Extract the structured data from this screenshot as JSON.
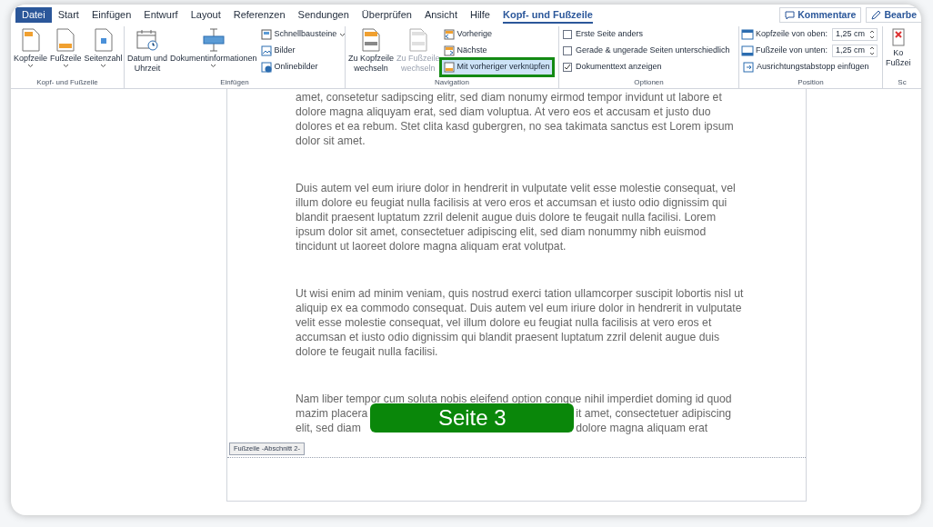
{
  "tabs": [
    {
      "label": "Datei",
      "kind": "file",
      "selected": false
    },
    {
      "label": "Start",
      "kind": "tab",
      "selected": false
    },
    {
      "label": "Einfügen",
      "kind": "tab",
      "selected": false
    },
    {
      "label": "Entwurf",
      "kind": "tab",
      "selected": false
    },
    {
      "label": "Layout",
      "kind": "tab",
      "selected": false
    },
    {
      "label": "Referenzen",
      "kind": "tab",
      "selected": false
    },
    {
      "label": "Sendungen",
      "kind": "tab",
      "selected": false
    },
    {
      "label": "Überprüfen",
      "kind": "tab",
      "selected": false
    },
    {
      "label": "Ansicht",
      "kind": "tab",
      "selected": false
    },
    {
      "label": "Hilfe",
      "kind": "tab",
      "selected": false
    },
    {
      "label": "Kopf- und Fußzeile",
      "kind": "tab",
      "selected": true
    }
  ],
  "top_buttons": [
    {
      "label": "Kommentare"
    },
    {
      "label": "Bearbe"
    }
  ],
  "ribbon_groups": [
    {
      "label": "Kopf- und Fußzeile",
      "items": [
        {
          "kind": "large",
          "lines": [
            "Kopfzeile"
          ],
          "dropdown": true
        },
        {
          "kind": "large",
          "lines": [
            "Fußzeile"
          ],
          "dropdown": true
        },
        {
          "kind": "large",
          "lines": [
            "Seitenzahl"
          ],
          "dropdown": true
        }
      ]
    },
    {
      "label": "Einfügen",
      "items": [
        {
          "kind": "large",
          "lines": [
            "Datum und",
            "Uhrzeit"
          ],
          "dropdown": false
        },
        {
          "kind": "large",
          "lines": [
            "Dokumentinformationen"
          ],
          "dropdown": true
        },
        {
          "kind": "small",
          "label": "Schnellbausteine",
          "dropdown": true
        },
        {
          "kind": "small",
          "label": "Bilder",
          "dropdown": false
        },
        {
          "kind": "small",
          "label": "Onlinebilder",
          "dropdown": false
        }
      ]
    },
    {
      "label": "Navigation",
      "items": [
        {
          "kind": "large",
          "lines": [
            "Zu Kopfzeile",
            "wechseln"
          ],
          "dropdown": false,
          "disabled": false,
          "on": false,
          "highlighted": false
        },
        {
          "kind": "large",
          "lines": [
            "Zu Fußzeile",
            "wechseln"
          ],
          "dropdown": false,
          "disabled": true,
          "on": false,
          "highlighted": false
        },
        {
          "kind": "small",
          "label": "Vorherige",
          "dropdown": false,
          "disabled": false,
          "on": false,
          "highlighted": false
        },
        {
          "kind": "small",
          "label": "Nächste",
          "dropdown": false,
          "disabled": false,
          "on": false,
          "highlighted": false
        },
        {
          "kind": "small",
          "label": "Mit vorheriger verknüpfen",
          "dropdown": false,
          "disabled": false,
          "on": true,
          "highlighted": true
        }
      ]
    },
    {
      "label": "Optionen",
      "items": [
        {
          "kind": "check",
          "label": "Erste Seite anders",
          "checked": false
        },
        {
          "kind": "check",
          "label": "Gerade & ungerade Seiten unterschiedlich",
          "checked": false
        },
        {
          "kind": "check",
          "label": "Dokumenttext anzeigen",
          "checked": true
        }
      ]
    },
    {
      "label": "Position",
      "items": [
        {
          "kind": "spin",
          "label": "Kopfzeile von oben:",
          "value": "1,25 cm"
        },
        {
          "kind": "spin",
          "label": "Fußzeile von unten:",
          "value": "1,25 cm"
        },
        {
          "kind": "small",
          "label": "Ausrichtungstabstopp einfügen",
          "dropdown": false
        }
      ]
    },
    {
      "label": "Sc",
      "items": [
        {
          "kind": "large",
          "lines": [
            "Ko",
            "Fußzei"
          ],
          "dropdown": false
        }
      ]
    }
  ],
  "document": {
    "paragraphs": [
      {
        "kind": "text",
        "text": "amet, consetetur sadipscing elitr, sed diam nonumy eirmod tempor invidunt ut labore et dolore magna aliquyam erat, sed diam voluptua. At vero eos et accusam et justo duo dolores et ea rebum. Stet clita kasd gubergren, no sea takimata sanctus est Lorem ipsum dolor sit amet."
      },
      {
        "kind": "text",
        "text": "Duis autem vel eum iriure dolor in hendrerit in vulputate velit esse molestie consequat, vel illum dolore eu feugiat nulla facilisis at vero eros et accumsan et iusto odio dignissim qui blandit praesent luptatum zzril delenit augue duis dolore te feugait nulla facilisi. Lorem ipsum dolor sit amet, consectetuer adipiscing elit, sed diam nonummy nibh euismod tincidunt ut laoreet dolore magna aliquam erat volutpat."
      },
      {
        "kind": "text",
        "text": "Ut wisi enim ad minim veniam, quis nostrud exerci tation ullamcorper suscipit lobortis nisl ut aliquip ex ea commodo consequat. Duis autem vel eum iriure dolor in hendrerit in vulputate velit esse molestie consequat, vel illum dolore eu feugiat nulla facilisis at vero eros et accumsan et iusto odio dignissim qui blandit praesent luptatum zzril delenit augue duis dolore te feugait nulla facilisi."
      },
      {
        "kind": "covered",
        "first_line": "Nam liber tempor cum soluta nobis eleifend option congue nihil imperdiet doming id quod",
        "left": [
          "mazim placera",
          "elit, sed diam"
        ],
        "right": [
          "it amet, consectetuer adipiscing",
          "dolore magna aliquam erat"
        ],
        "badge": "Seite 3"
      }
    ],
    "footer_tag": "Fußzeile -Abschnitt 2-"
  }
}
